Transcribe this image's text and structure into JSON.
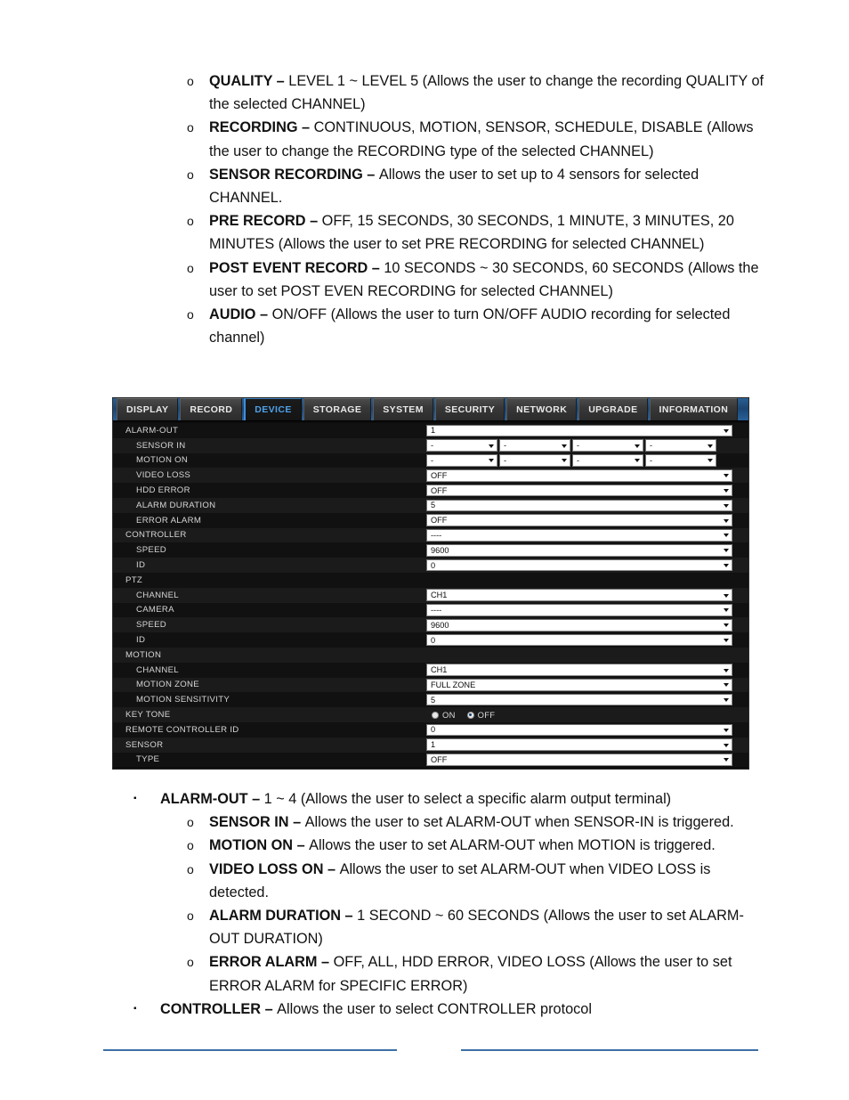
{
  "document": {
    "top_list": [
      {
        "level": 2,
        "bullet": "o",
        "term": "QUALITY – ",
        "text": "LEVEL 1 ~ LEVEL 5 (Allows the user to change the recording QUALITY of the selected CHANNEL)"
      },
      {
        "level": 2,
        "bullet": "o",
        "term": "RECORDING – ",
        "text": "CONTINUOUS, MOTION, SENSOR, SCHEDULE, DISABLE (Allows the user to change the RECORDING type of the selected CHANNEL)"
      },
      {
        "level": 2,
        "bullet": "o",
        "term": "SENSOR RECORDING – ",
        "text": "Allows the user to set up to 4 sensors for selected CHANNEL."
      },
      {
        "level": 2,
        "bullet": "o",
        "term": "PRE RECORD – ",
        "text": "OFF, 15 SECONDS, 30 SECONDS, 1 MINUTE, 3 MINUTES, 20 MINUTES (Allows the user to set PRE RECORDING for selected CHANNEL)"
      },
      {
        "level": 2,
        "bullet": "o",
        "term": "POST EVENT RECORD – ",
        "text": "10 SECONDS ~ 30 SECONDS, 60 SECONDS (Allows the user to set POST EVEN RECORDING for selected CHANNEL)"
      },
      {
        "level": 2,
        "bullet": "o",
        "term": "AUDIO – ",
        "text": "ON/OFF (Allows the user to turn ON/OFF AUDIO recording for selected channel)"
      }
    ],
    "bottom_list": [
      {
        "level": 1,
        "bullet": "▪",
        "term": "ALARM-OUT – ",
        "text": "1 ~ 4 (Allows the user to select a specific alarm output terminal)"
      },
      {
        "level": 2,
        "bullet": "o",
        "term": "SENSOR IN – ",
        "text": "Allows the user to set ALARM-OUT when SENSOR-IN is triggered."
      },
      {
        "level": 2,
        "bullet": "o",
        "term": "MOTION ON – ",
        "text": "Allows the user to set ALARM-OUT when MOTION is triggered."
      },
      {
        "level": 2,
        "bullet": "o",
        "term": "VIDEO LOSS ON – ",
        "text": "Allows the user to set ALARM-OUT when VIDEO LOSS is detected."
      },
      {
        "level": 2,
        "bullet": "o",
        "term": "ALARM DURATION – ",
        "text": "1 SECOND ~ 60 SECONDS (Allows the user to set ALARM-OUT DURATION)"
      },
      {
        "level": 2,
        "bullet": "o",
        "term": "ERROR ALARM – ",
        "text": "OFF, ALL, HDD ERROR, VIDEO LOSS (Allows the user to set ERROR ALARM for SPECIFIC ERROR)"
      },
      {
        "level": 1,
        "bullet": "▪",
        "term": "CONTROLLER – ",
        "text": "Allows the user to select CONTROLLER protocol"
      }
    ]
  },
  "dvr": {
    "tabs": [
      {
        "label": "DISPLAY",
        "active": false
      },
      {
        "label": "RECORD",
        "active": false
      },
      {
        "label": "DEVICE",
        "active": true
      },
      {
        "label": "STORAGE",
        "active": false
      },
      {
        "label": "SYSTEM",
        "active": false
      },
      {
        "label": "SECURITY",
        "active": false
      },
      {
        "label": "NETWORK",
        "active": false
      },
      {
        "label": "UPGRADE",
        "active": false
      },
      {
        "label": "INFORMATION",
        "active": false
      }
    ],
    "active_tab": "DEVICE",
    "accent_color": "#3e8ddd",
    "rows": [
      {
        "label": "ALARM-OUT",
        "indent": false,
        "type": "select",
        "value": "1"
      },
      {
        "label": "SENSOR IN",
        "indent": true,
        "type": "quad",
        "values": [
          "-",
          "-",
          "-",
          "-"
        ]
      },
      {
        "label": "MOTION ON",
        "indent": true,
        "type": "quad",
        "values": [
          "-",
          "-",
          "-",
          "-"
        ]
      },
      {
        "label": "VIDEO LOSS",
        "indent": true,
        "type": "select",
        "value": "OFF"
      },
      {
        "label": "HDD ERROR",
        "indent": true,
        "type": "select",
        "value": "OFF"
      },
      {
        "label": "ALARM DURATION",
        "indent": true,
        "type": "select",
        "value": "5"
      },
      {
        "label": "ERROR ALARM",
        "indent": true,
        "type": "select",
        "value": "OFF"
      },
      {
        "label": "CONTROLLER",
        "indent": false,
        "type": "select",
        "value": "----"
      },
      {
        "label": "SPEED",
        "indent": true,
        "type": "select",
        "value": "9600"
      },
      {
        "label": "ID",
        "indent": true,
        "type": "select",
        "value": "0"
      },
      {
        "label": "PTZ",
        "indent": false,
        "type": "none",
        "value": ""
      },
      {
        "label": "CHANNEL",
        "indent": true,
        "type": "select",
        "value": "CH1"
      },
      {
        "label": "CAMERA",
        "indent": true,
        "type": "select",
        "value": "----"
      },
      {
        "label": "SPEED",
        "indent": true,
        "type": "select",
        "value": "9600"
      },
      {
        "label": "ID",
        "indent": true,
        "type": "select",
        "value": "0"
      },
      {
        "label": "MOTION",
        "indent": false,
        "type": "none",
        "value": ""
      },
      {
        "label": "CHANNEL",
        "indent": true,
        "type": "select",
        "value": "CH1"
      },
      {
        "label": "MOTION ZONE",
        "indent": true,
        "type": "select",
        "value": "FULL ZONE"
      },
      {
        "label": "MOTION SENSITIVITY",
        "indent": true,
        "type": "select",
        "value": "5"
      },
      {
        "label": "KEY TONE",
        "indent": false,
        "type": "radio",
        "options": [
          "ON",
          "OFF"
        ],
        "selected": "OFF"
      },
      {
        "label": "REMOTE CONTROLLER ID",
        "indent": false,
        "type": "select",
        "value": "0"
      },
      {
        "label": "SENSOR",
        "indent": false,
        "type": "select",
        "value": "1"
      },
      {
        "label": "TYPE",
        "indent": true,
        "type": "select",
        "value": "OFF"
      }
    ]
  }
}
